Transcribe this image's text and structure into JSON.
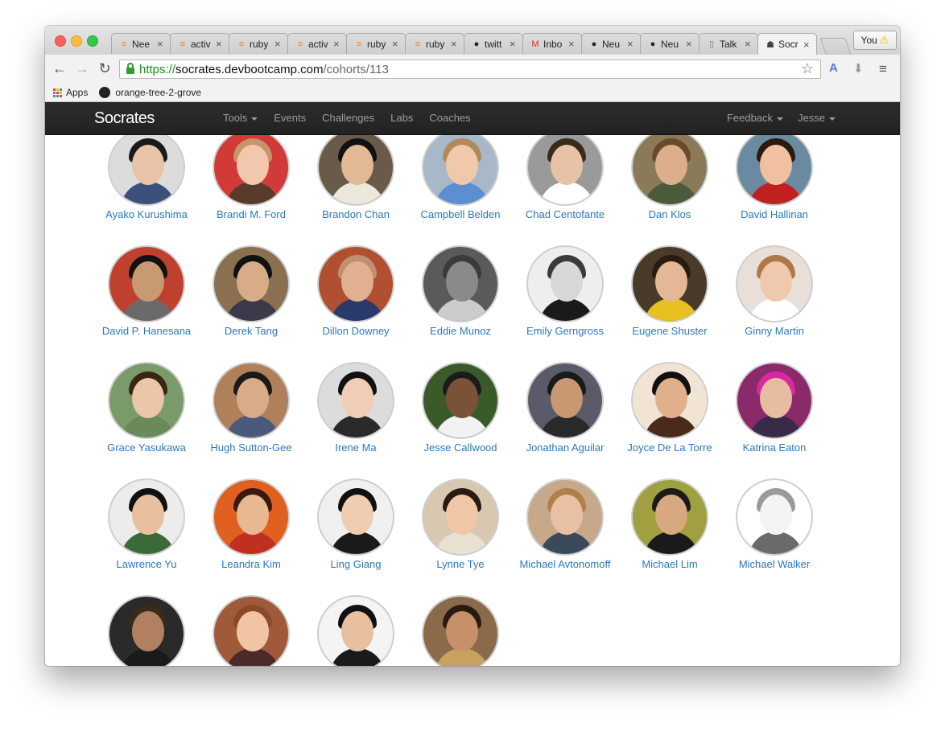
{
  "browser": {
    "tabs": [
      {
        "title": "Nee",
        "icon": "stackoverflow-icon"
      },
      {
        "title": "activ",
        "icon": "stackoverflow-icon"
      },
      {
        "title": "ruby",
        "icon": "stackoverflow-icon"
      },
      {
        "title": "activ",
        "icon": "stackoverflow-icon"
      },
      {
        "title": "ruby",
        "icon": "stackoverflow-icon"
      },
      {
        "title": "ruby",
        "icon": "stackoverflow-icon"
      },
      {
        "title": "twitt",
        "icon": "github-icon"
      },
      {
        "title": "Inbo",
        "icon": "gmail-icon"
      },
      {
        "title": "Neu",
        "icon": "github-icon"
      },
      {
        "title": "Neu",
        "icon": "github-icon"
      },
      {
        "title": "Talk",
        "icon": "page-icon"
      },
      {
        "title": "Socr",
        "icon": "socrates-icon",
        "active": true
      }
    ],
    "profile_label": "You",
    "url": {
      "scheme": "https://",
      "host": "socrates.devbootcamp.com",
      "path": "/cohorts/113"
    },
    "bookmarks": [
      {
        "label": "Apps",
        "icon": "apps-grid-icon"
      },
      {
        "label": "orange-tree-2-grove",
        "icon": "github-icon"
      }
    ]
  },
  "navbar": {
    "brand": "Socrates",
    "links": [
      {
        "label": "Tools",
        "dropdown": true
      },
      {
        "label": "Events"
      },
      {
        "label": "Challenges"
      },
      {
        "label": "Labs"
      },
      {
        "label": "Coaches"
      }
    ],
    "right_links": [
      {
        "label": "Feedback",
        "dropdown": true
      },
      {
        "label": "Jesse",
        "dropdown": true
      }
    ]
  },
  "people": [
    {
      "name": "Ayako Kurushima",
      "skin": "#e8c3a8",
      "hair": "#1a1a1a",
      "shirt": "#3a4f7a",
      "bg": "#dcdcdc"
    },
    {
      "name": "Brandi M. Ford",
      "skin": "#f2c7ad",
      "hair": "#c8956a",
      "shirt": "#5a3a2a",
      "bg": "#d23a3a"
    },
    {
      "name": "Brandon Chan",
      "skin": "#e2b994",
      "hair": "#111111",
      "shirt": "#ece8dc",
      "bg": "#6a5a4a"
    },
    {
      "name": "Campbell Belden",
      "skin": "#f0c8aa",
      "hair": "#b08a5a",
      "shirt": "#5a8fd0",
      "bg": "#a8b8c8"
    },
    {
      "name": "Chad Centofante",
      "skin": "#e8c2a6",
      "hair": "#3a2a1a",
      "shirt": "#ffffff",
      "bg": "#9a9a9a"
    },
    {
      "name": "Dan Klos",
      "skin": "#dcae8c",
      "hair": "#6a4a2a",
      "shirt": "#4a5a3a",
      "bg": "#8a7a5a"
    },
    {
      "name": "David Hallinan",
      "skin": "#f0c0a0",
      "hair": "#2a1a10",
      "shirt": "#c02020",
      "bg": "#6a8aa0"
    },
    {
      "name": "David P. Hanesana",
      "skin": "#c89a72",
      "hair": "#111111",
      "shirt": "#6a6a6a",
      "bg": "#c04030"
    },
    {
      "name": "Derek Tang",
      "skin": "#d8ac86",
      "hair": "#111111",
      "shirt": "#3a3a4a",
      "bg": "#8a7050"
    },
    {
      "name": "Dillon Downey",
      "skin": "#e0b090",
      "hair": "#c09070",
      "shirt": "#2a3a6a",
      "bg": "#b05030"
    },
    {
      "name": "Eddie Munoz",
      "skin": "#8a8a8a",
      "hair": "#3a3a3a",
      "shirt": "#cccccc",
      "bg": "#5a5a5a"
    },
    {
      "name": "Emily Gerngross",
      "skin": "#d8d8d8",
      "hair": "#3a3a3a",
      "shirt": "#1a1a1a",
      "bg": "#eeeeee"
    },
    {
      "name": "Eugene Shuster",
      "skin": "#e4b896",
      "hair": "#2a1a10",
      "shirt": "#e8c020",
      "bg": "#4a3a2a"
    },
    {
      "name": "Ginny Martin",
      "skin": "#f0c8ae",
      "hair": "#b07848",
      "shirt": "#ffffff",
      "bg": "#e8e0d8"
    },
    {
      "name": "Grace Yasukawa",
      "skin": "#ecc6a8",
      "hair": "#3a2414",
      "shirt": "#6a8a5a",
      "bg": "#7a9a6a"
    },
    {
      "name": "Hugh Sutton-Gee",
      "skin": "#d8ac88",
      "hair": "#1a1a1a",
      "shirt": "#4a5a7a",
      "bg": "#b0805a"
    },
    {
      "name": "Irene Ma",
      "skin": "#f0cdb4",
      "hair": "#111111",
      "shirt": "#2a2a2a",
      "bg": "#dcdcdc"
    },
    {
      "name": "Jesse Callwood",
      "skin": "#7a5238",
      "hair": "#1a1a1a",
      "shirt": "#f2f2f2",
      "bg": "#3a5a2a"
    },
    {
      "name": "Jonathan Aguilar",
      "skin": "#c89872",
      "hair": "#1a1a1a",
      "shirt": "#2a2a2a",
      "bg": "#5a5a6a"
    },
    {
      "name": "Joyce De La Torre",
      "skin": "#e0b08a",
      "hair": "#111111",
      "shirt": "#4a2a1a",
      "bg": "#f2e4d4"
    },
    {
      "name": "Katrina Eaton",
      "skin": "#e8bca0",
      "hair": "#d82aa0",
      "shirt": "#3a2a4a",
      "bg": "#8a2a6a"
    },
    {
      "name": "Lawrence Yu",
      "skin": "#e8c0a0",
      "hair": "#111111",
      "shirt": "#3a6a3a",
      "bg": "#ececec"
    },
    {
      "name": "Leandra Kim",
      "skin": "#e8b892",
      "hair": "#3a1a10",
      "shirt": "#c03020",
      "bg": "#e06020"
    },
    {
      "name": "Ling Giang",
      "skin": "#f0ccb0",
      "hair": "#111111",
      "shirt": "#1a1a1a",
      "bg": "#f0f0f0"
    },
    {
      "name": "Lynne Tye",
      "skin": "#f0c8a8",
      "hair": "#2a1a10",
      "shirt": "#e8e0d0",
      "bg": "#d8c8b0"
    },
    {
      "name": "Michael Avtonomoff",
      "skin": "#e8c0a4",
      "hair": "#b0804a",
      "shirt": "#3a4a5a",
      "bg": "#c8a88a"
    },
    {
      "name": "Michael Lim",
      "skin": "#d8a880",
      "hair": "#1a1a1a",
      "shirt": "#1a1a1a",
      "bg": "#a0a040"
    },
    {
      "name": "Michael Walker",
      "skin": "#f4f4f4",
      "hair": "#9a9a9a",
      "shirt": "#6a6a6a",
      "bg": "#ffffff"
    },
    {
      "name": "",
      "skin": "#b08060",
      "hair": "#3a2a1a",
      "shirt": "#1a1a1a",
      "bg": "#2a2a2a"
    },
    {
      "name": "",
      "skin": "#f0c4a4",
      "hair": "#8a4a2a",
      "shirt": "#4a2a2a",
      "bg": "#a05a3a"
    },
    {
      "name": "",
      "skin": "#e8c0a0",
      "hair": "#111111",
      "shirt": "#1a1a1a",
      "bg": "#f4f4f4"
    },
    {
      "name": "",
      "skin": "#c89068",
      "hair": "#2a1a10",
      "shirt": "#c8a060",
      "bg": "#8a6a4a"
    }
  ]
}
